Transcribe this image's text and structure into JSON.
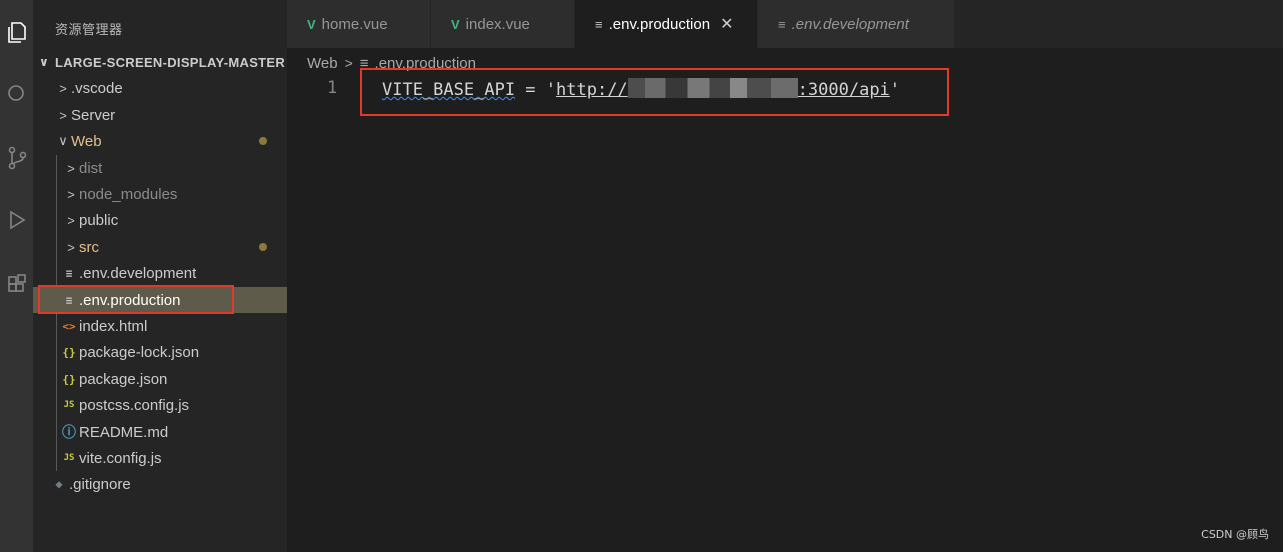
{
  "sidebar": {
    "title": "资源管理器",
    "root": "LARGE-SCREEN-DISPLAY-MASTER",
    "items": [
      {
        "label": ".vscode",
        "chev": ">",
        "icon": ""
      },
      {
        "label": "Server",
        "chev": ">",
        "icon": ""
      },
      {
        "label": "Web",
        "chev": "∨",
        "icon": ""
      },
      {
        "label": "dist",
        "chev": ">",
        "icon": ""
      },
      {
        "label": "node_modules",
        "chev": ">",
        "icon": ""
      },
      {
        "label": "public",
        "chev": ">",
        "icon": ""
      },
      {
        "label": "src",
        "chev": ">",
        "icon": ""
      },
      {
        "label": ".env.development",
        "chev": "",
        "icon": "≡"
      },
      {
        "label": ".env.production",
        "chev": "",
        "icon": "≡"
      },
      {
        "label": "index.html",
        "chev": "",
        "icon": "<>"
      },
      {
        "label": "package-lock.json",
        "chev": "",
        "icon": "{}"
      },
      {
        "label": "package.json",
        "chev": "",
        "icon": "{}"
      },
      {
        "label": "postcss.config.js",
        "chev": "",
        "icon": "JS"
      },
      {
        "label": "README.md",
        "chev": "",
        "icon": "ⓘ"
      },
      {
        "label": "vite.config.js",
        "chev": "",
        "icon": "JS"
      },
      {
        "label": ".gitignore",
        "chev": "",
        "icon": "◆"
      }
    ]
  },
  "tabs": [
    {
      "label": "home.vue",
      "icon": "V"
    },
    {
      "label": "index.vue",
      "icon": "V"
    },
    {
      "label": ".env.production",
      "icon": "≡",
      "close": "✕"
    },
    {
      "label": ".env.development",
      "icon": "≡"
    }
  ],
  "breadcrumb": {
    "folder": "Web",
    "sep": ">",
    "file_icon": "≡",
    "file": ".env.production"
  },
  "editor": {
    "line_number": "1",
    "code_key": "VITE_BASE_API",
    "code_eq": " = '",
    "code_url_start": "http://",
    "code_url_end": ":3000/api",
    "code_close": "'"
  },
  "watermark": "CSDN @顾鸟",
  "colors": {
    "accent_box": "#e23a2a",
    "vue_icon": "#41b883",
    "modified": "#e2c08d",
    "json_icon": "#cbcb41",
    "html_icon": "#e37933",
    "info_icon": "#519aba"
  }
}
